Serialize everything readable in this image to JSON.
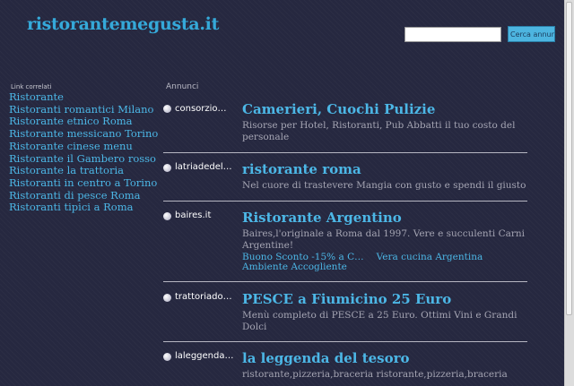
{
  "site": {
    "title": "ristorantemegusta.it"
  },
  "search": {
    "value": "",
    "placeholder": "",
    "button_label": "Cerca annunci"
  },
  "sidebar": {
    "heading": "Link correlati",
    "items": [
      "Ristorante",
      "Ristoranti romantici Milano",
      "Ristorante etnico Roma",
      "Ristorante messicano Torino",
      "Ristorante cinese menu",
      "Ristorante il Gambero rosso",
      "Ristorante la trattoria",
      "Ristoranti in centro a Torino",
      "Ristoranti di pesce Roma",
      "Ristoranti tipici a Roma"
    ]
  },
  "ads": {
    "heading": "Annunci",
    "items": [
      {
        "domain": "consorzio…",
        "title": "Camerieri, Cuochi Pulizie",
        "description": "Risorse per Hotel, Ristoranti, Pub Abbatti il tuo costo del personale"
      },
      {
        "domain": "latriadedel…",
        "title": "ristorante roma",
        "description": "Nel cuore di trastevere Mangia con gusto e spendi il giusto"
      },
      {
        "domain": "baires.it",
        "title": "Ristorante Argentino",
        "description": "Baires,l'originale a Roma dal 1997. Vere e succulenti Carni Argentine!",
        "sitelinks": [
          "Buono Sconto -15% a C…",
          "Vera cucina Argentina",
          "Ambiente Accogliente"
        ]
      },
      {
        "domain": "trattoriado…",
        "title": "PESCE a Fiumicino 25 Euro",
        "description": "Menù completo di PESCE a 25 Euro. Ottimi Vini e Grandi Dolci"
      },
      {
        "domain": "laleggenda…",
        "title": "la leggenda del tesoro",
        "description": "ristorante,pizzeria,braceria ristorante,pizzeria,braceria"
      }
    ]
  }
}
